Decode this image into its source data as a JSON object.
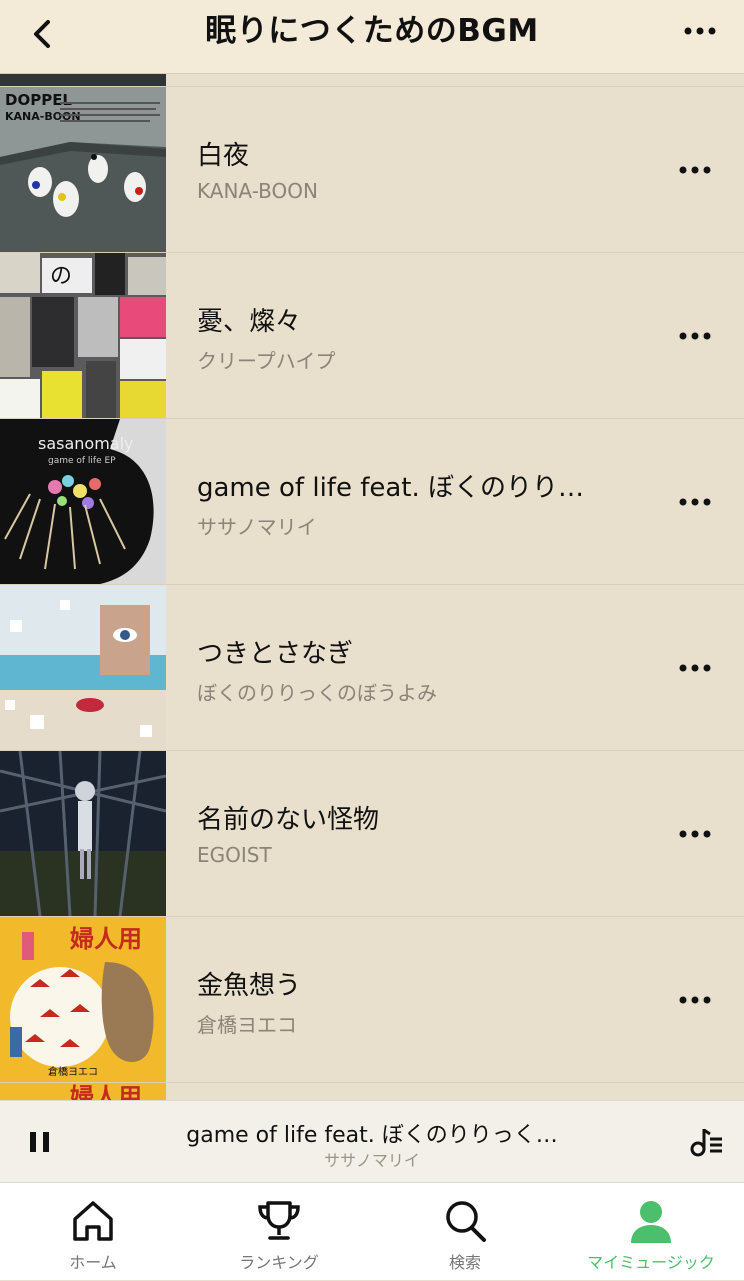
{
  "header": {
    "title": "眠りにつくためのBGM",
    "back_icon": "chevron-left-icon",
    "more_icon": "more-horizontal-icon"
  },
  "tracks": [
    {
      "title": "白夜",
      "artist": "KANA-BOON",
      "cover_text_1": "DOPPEL",
      "cover_text_2": "KANA-BOON"
    },
    {
      "title": "憂、燦々",
      "artist": "クリープハイプ",
      "cover_text_1": "の"
    },
    {
      "title": "game of life feat. ぼくのりり…",
      "artist": "ササノマリイ",
      "cover_text_1": "sasanomaly",
      "cover_text_2": "game of life EP"
    },
    {
      "title": "つきとさなぎ",
      "artist": "ぼくのりりっくのぼうよみ"
    },
    {
      "title": "名前のない怪物",
      "artist": "EGOIST"
    },
    {
      "title": "金魚想う",
      "artist": "倉橋ヨエコ",
      "cover_text_1": "婦人用",
      "cover_text_2": "倉橋ヨエコ"
    }
  ],
  "partial_cover_text": "婦人用",
  "player": {
    "now_playing_title": "game of life feat. ぼくのりりっく…",
    "now_playing_artist": "ササノマリイ",
    "state": "playing"
  },
  "tabs": [
    {
      "label": "ホーム",
      "icon": "home-icon",
      "active": false
    },
    {
      "label": "ランキング",
      "icon": "trophy-icon",
      "active": false
    },
    {
      "label": "検索",
      "icon": "search-icon",
      "active": false
    },
    {
      "label": "マイミュージック",
      "icon": "person-icon",
      "active": true
    }
  ],
  "colors": {
    "background": "#e8dfcc",
    "header": "#f3ead7",
    "accent_green": "#4bbf6b",
    "secondary_text": "#8a8578"
  }
}
